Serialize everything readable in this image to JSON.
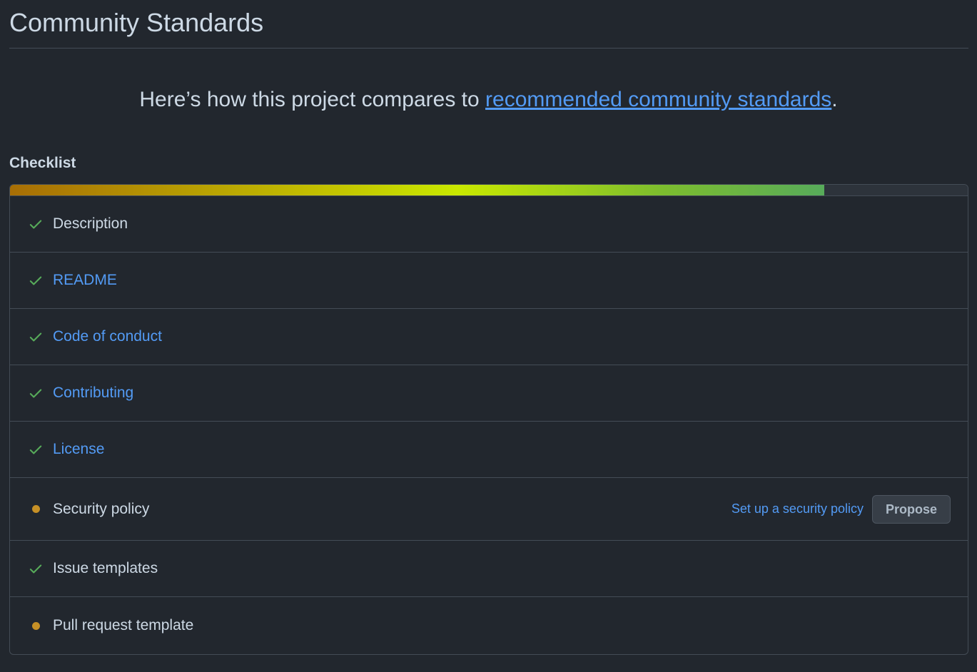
{
  "header": {
    "title": "Community Standards"
  },
  "lead": {
    "prefix": "Here’s how this project compares to ",
    "link_text": "recommended community standards",
    "suffix": "."
  },
  "checklist": {
    "title": "Checklist",
    "progress": 0.85,
    "items": [
      {
        "label": "Description",
        "status": "done",
        "is_link": false
      },
      {
        "label": "README",
        "status": "done",
        "is_link": true
      },
      {
        "label": "Code of conduct",
        "status": "done",
        "is_link": true
      },
      {
        "label": "Contributing",
        "status": "done",
        "is_link": true
      },
      {
        "label": "License",
        "status": "done",
        "is_link": true
      },
      {
        "label": "Security policy",
        "status": "missing",
        "is_link": false,
        "action_link": "Set up a security policy",
        "action_button": "Propose"
      },
      {
        "label": "Issue templates",
        "status": "done",
        "is_link": false
      },
      {
        "label": "Pull request template",
        "status": "missing",
        "is_link": false
      }
    ]
  },
  "colors": {
    "done": "#57ab5a",
    "missing": "#c69026",
    "link": "#539bf5"
  },
  "icons": {
    "done": "check-icon",
    "missing": "dot-icon"
  }
}
